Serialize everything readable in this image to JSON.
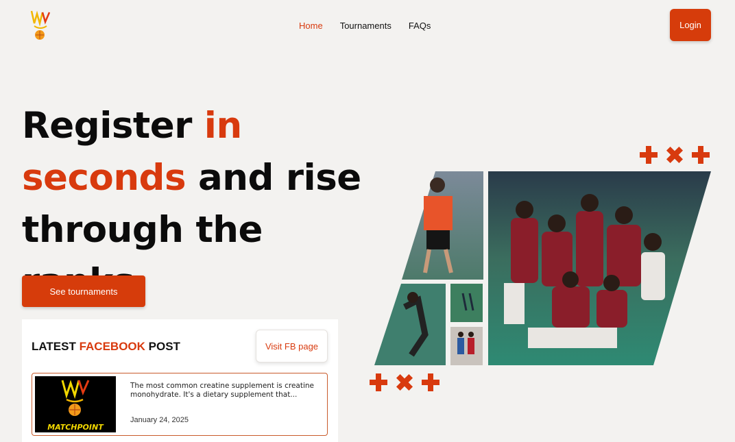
{
  "nav": {
    "items": [
      {
        "label": "Home",
        "active": true
      },
      {
        "label": "Tournaments",
        "active": false
      },
      {
        "label": "FAQs",
        "active": false
      }
    ],
    "login_label": "Login"
  },
  "hero": {
    "line1_a": "Register ",
    "line1_b": "in",
    "line2_a": "seconds",
    "line2_b": " and rise",
    "line3": "through the ranks",
    "cta_label": "See tournaments"
  },
  "facebook": {
    "heading_a": "LATEST ",
    "heading_b": "FACEBOOK",
    "heading_c": " POST",
    "visit_label": "Visit FB page",
    "post_text": "The most common creatine supplement is creatine monohydrate. It's a dietary supplement that...",
    "post_date": "January 24, 2025",
    "thumb_brand": "MATCHPOINT"
  },
  "colors": {
    "accent": "#d63c0b",
    "background": "#f3f2f0"
  }
}
